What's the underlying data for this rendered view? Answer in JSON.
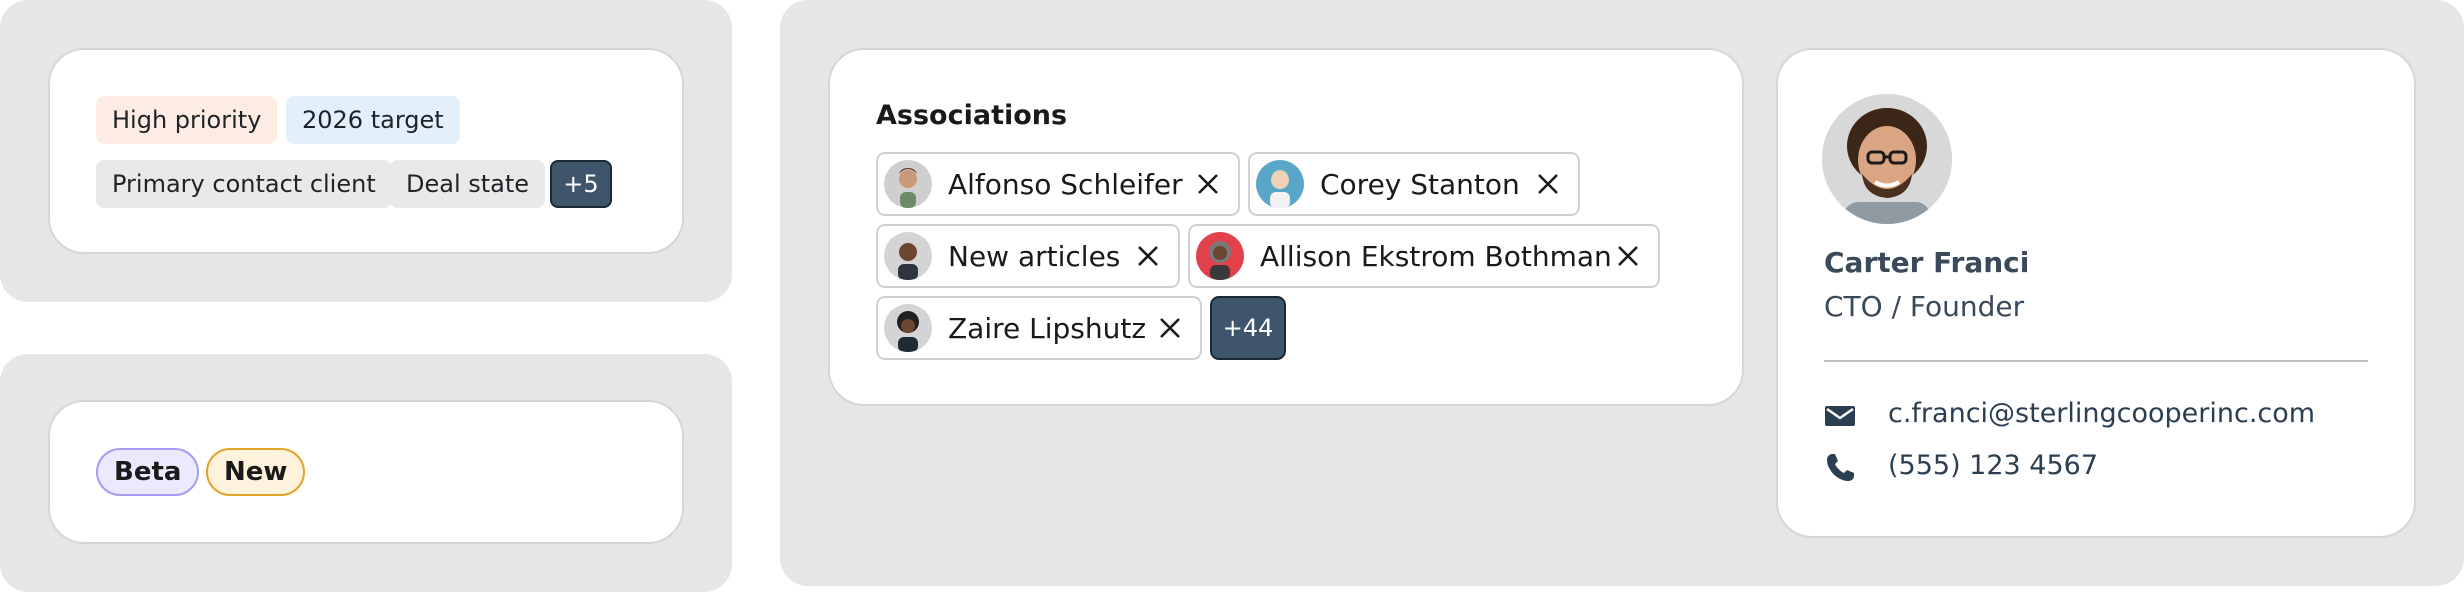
{
  "tags_card": {
    "tags": [
      {
        "label": "High priority",
        "bg": "#fdece4"
      },
      {
        "label": "2026 target",
        "bg": "#e1f0fb"
      },
      {
        "label": "Primary contact client",
        "bg": "#e9e9e9"
      },
      {
        "label": "Deal state",
        "bg": "#e9e9e9"
      }
    ],
    "more_label": "+5"
  },
  "badges_card": {
    "badges": [
      {
        "label": "Beta",
        "bg": "#ece9fd",
        "border": "#a99cf0"
      },
      {
        "label": "New",
        "bg": "#fdf3dc",
        "border": "#e0a52a"
      }
    ]
  },
  "associations": {
    "title": "Associations",
    "chips": [
      {
        "name": "Alfonso Schleifer",
        "icon": "avatar-alfonso",
        "avatar_bg": "#cfcfcf"
      },
      {
        "name": "Corey Stanton",
        "icon": "avatar-corey",
        "avatar_bg": "#5aa6c8"
      },
      {
        "name": "New articles",
        "icon": "avatar-new-articles",
        "avatar_bg": "#d4d4d4"
      },
      {
        "name": "Allison Ekstrom Bothman",
        "icon": "avatar-allison",
        "avatar_bg": "#e0414a"
      },
      {
        "name": "Zaire Lipshutz",
        "icon": "avatar-zaire",
        "avatar_bg": "#d4d4d4"
      }
    ],
    "more_label": "+44",
    "remove_icon": "close-icon"
  },
  "contact_card": {
    "name": "Carter Franci",
    "role": "CTO / Founder",
    "email": "c.franci@sterlingcooperinc.com",
    "phone": "(555) 123 4567",
    "email_icon": "envelope-icon",
    "phone_icon": "phone-icon"
  },
  "colors": {
    "panel_bg": "#e6e6e6",
    "dark_badge": "#3e556b",
    "contact_text": "#3b4a5a"
  }
}
